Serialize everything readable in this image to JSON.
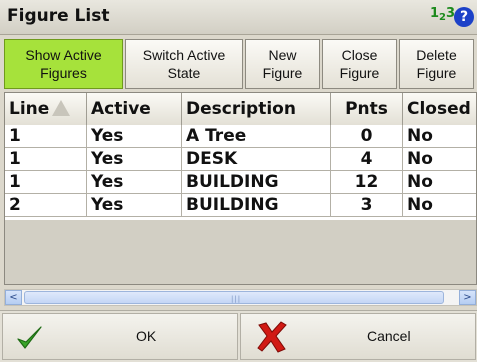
{
  "window": {
    "title": "Figure List",
    "number_icon_main": "1",
    "number_icon_sub": "2",
    "number_icon_tail": "3",
    "help_label": "?"
  },
  "toolbar": [
    {
      "label": "Show Active\nFigures",
      "active": true
    },
    {
      "label": "Switch Active\nState",
      "active": false
    },
    {
      "label": "New\nFigure",
      "active": false
    },
    {
      "label": "Close\nFigure",
      "active": false
    },
    {
      "label": "Delete\nFigure",
      "active": false
    }
  ],
  "table": {
    "columns": [
      "Line",
      "Active",
      "Description",
      "Pnts",
      "Closed"
    ],
    "rows": [
      [
        "1",
        "Yes",
        "A Tree",
        "0",
        "No"
      ],
      [
        "1",
        "Yes",
        "DESK",
        "4",
        "No"
      ],
      [
        "1",
        "Yes",
        "BUILDING",
        "12",
        "No"
      ],
      [
        "2",
        "Yes",
        "BUILDING",
        "3",
        "No"
      ]
    ]
  },
  "scrollbar": {
    "left_arrow": "<",
    "right_arrow": ">",
    "grip": "|||"
  },
  "buttons": {
    "ok_label": "OK",
    "cancel_label": "Cancel"
  },
  "colors": {
    "active_toolbar": "#a6e23b",
    "help_icon": "#1c41c8",
    "ok_check": "#3aa52a",
    "cancel_x": "#d11a14"
  },
  "icons": {
    "sort": "triangle-up-icon",
    "ok": "checkmark-icon",
    "cancel": "x-mark-icon"
  }
}
